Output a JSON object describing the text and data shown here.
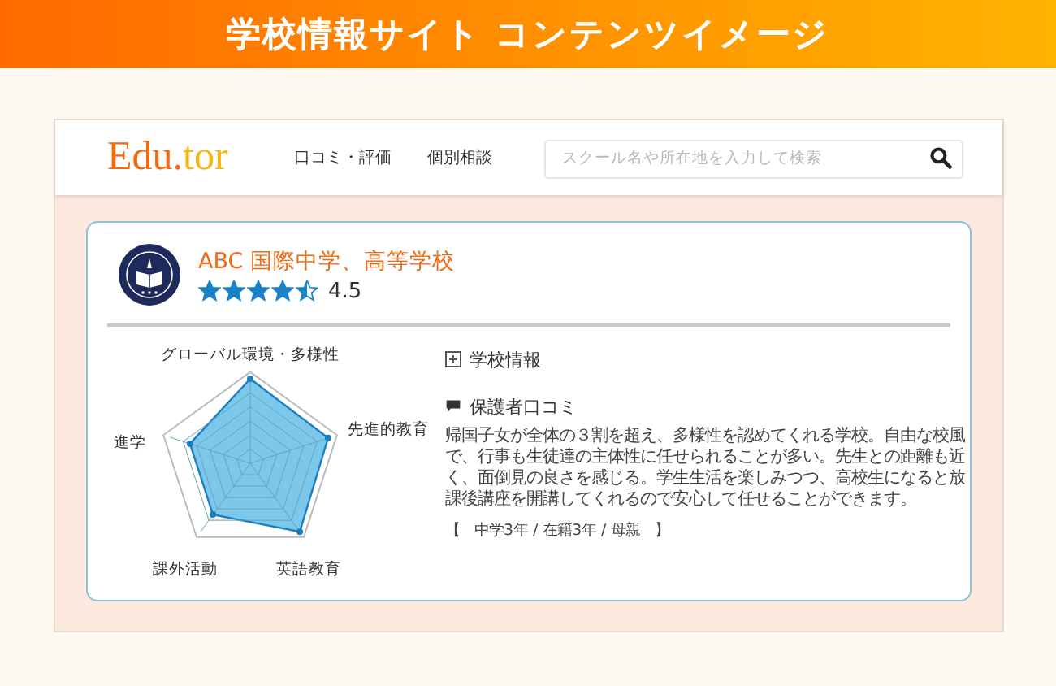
{
  "banner": {
    "title": "学校情報サイト コンテンツイメージ"
  },
  "site": {
    "logo": [
      "Edu.",
      "tor"
    ],
    "nav": [
      "口コミ・評価",
      "個別相談"
    ],
    "search": {
      "placeholder": "スクール名や所在地を入力して検索"
    }
  },
  "school": {
    "name": "ABC 国際中学、高等学校",
    "stars": 4.5,
    "rating": "4.5"
  },
  "radar": {
    "axes": [
      "グローバル環境・多様性",
      "先進的教育",
      "英語教育",
      "課外活動",
      "進学"
    ]
  },
  "info": {
    "label": "学校情報",
    "expanded": false
  },
  "review": {
    "heading": "保護者口コミ",
    "text": "帰国子女が全体の３割を超え、多様性を認めてくれる学校。自由な校風で、行事も生徒達の主体性に任せられることが多い。先生との距離も近く、面倒見の良さを感じる。学生生活を楽しみつつ、高校生になると放課後講座を開講してくれるので安心して任せることができます。",
    "meta": "【　中学3年 / 在籍3年 / 母親　】"
  }
}
